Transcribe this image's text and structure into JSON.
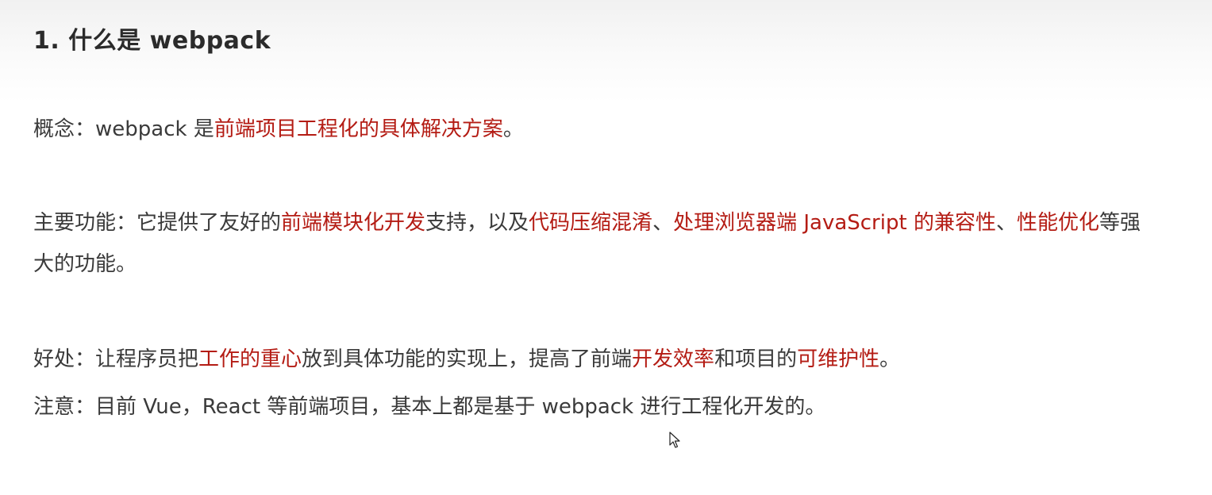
{
  "heading": "1. 什么是 webpack",
  "concept": {
    "label": "概念：webpack 是",
    "hl": "前端项目工程化的具体解决方案",
    "end": "。"
  },
  "features": {
    "t1": "主要功能：它提供了友好的",
    "h1": "前端模块化开发",
    "t2": "支持，以及",
    "h2": "代码压缩混淆",
    "t3": "、",
    "h3": "处理浏览器端 JavaScript 的兼容性",
    "t4": "、",
    "h4": "性能优化",
    "t5": "等强大的功能。"
  },
  "benefit": {
    "t1": "好处：让程序员把",
    "h1": "工作的重心",
    "t2": "放到具体功能的实现上，提高了前端",
    "h2": "开发效率",
    "t3": "和项目的",
    "h3": "可维护性",
    "t4": "。"
  },
  "note": "注意：目前 Vue，React 等前端项目，基本上都是基于 webpack 进行工程化开发的。"
}
